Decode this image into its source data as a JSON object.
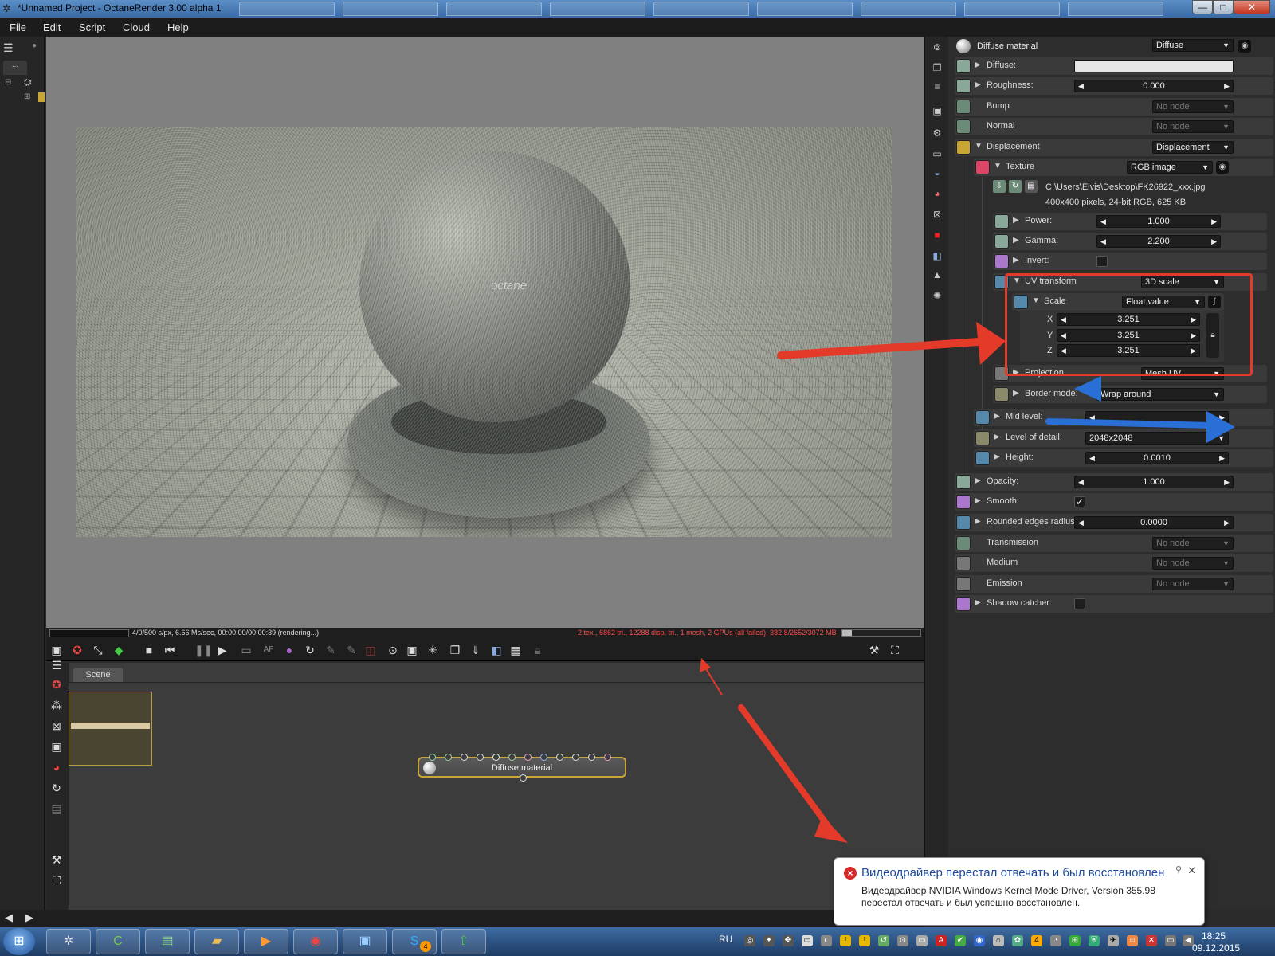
{
  "window": {
    "title": "*Unnamed Project - OctaneRender 3.00 alpha 1",
    "controls": [
      "—",
      "□",
      "✕"
    ]
  },
  "menu": [
    "File",
    "Edit",
    "Script",
    "Cloud",
    "Help"
  ],
  "left_panel": {
    "tab_label": "..."
  },
  "render_status": {
    "left": "4/0/500 s/px, 6.66 Ms/sec, 00:00:00/00:00:39 (rendering...)",
    "right": "2 tex., 6862 tri., 12288 disp. tri., 1 mesh, 2 GPUs (all failed), 382.8/2652/3072 MB"
  },
  "render_image": {
    "logo_text": "octane"
  },
  "graph": {
    "tab": "Scene",
    "node_label": "Diffuse material"
  },
  "inspector": {
    "header": {
      "title": "Diffuse material",
      "type": "Diffuse"
    },
    "diffuse": {
      "label": "Diffuse:"
    },
    "roughness": {
      "label": "Roughness:",
      "value": "0.000"
    },
    "bump": {
      "label": "Bump",
      "value": "No node"
    },
    "normal": {
      "label": "Normal",
      "value": "No node"
    },
    "displacement": {
      "label": "Displacement",
      "value": "Displacement"
    },
    "texture": {
      "label": "Texture",
      "value": "RGB image"
    },
    "file": {
      "path": "C:\\Users\\Elvis\\Desktop\\FK26922_xxx.jpg",
      "info": "400x400 pixels, 24-bit RGB, 625 KB"
    },
    "power": {
      "label": "Power:",
      "value": "1.000"
    },
    "gamma": {
      "label": "Gamma:",
      "value": "2.200"
    },
    "invert": {
      "label": "Invert:"
    },
    "uv_transform": {
      "label": "UV transform",
      "value": "3D scale"
    },
    "scale": {
      "label": "Scale",
      "value": "Float value",
      "x_label": "X",
      "y_label": "Y",
      "z_label": "Z",
      "x": "3.251",
      "y": "3.251",
      "z": "3.251"
    },
    "projection": {
      "label": "Projection",
      "value": "Mesh UV"
    },
    "border_mode": {
      "label": "Border mode:",
      "value": "Wrap around"
    },
    "mid_level": {
      "label": "Mid level:"
    },
    "level_of_detail": {
      "label": "Level of detail:",
      "value": "2048x2048"
    },
    "height": {
      "label": "Height:",
      "value": "0.0010"
    },
    "opacity": {
      "label": "Opacity:",
      "value": "1.000"
    },
    "smooth": {
      "label": "Smooth:",
      "checked": "✓"
    },
    "rounded": {
      "label": "Rounded edges radius:",
      "value": "0.0000"
    },
    "transmission": {
      "label": "Transmission",
      "value": "No node"
    },
    "medium": {
      "label": "Medium",
      "value": "No node"
    },
    "emission": {
      "label": "Emission",
      "value": "No node"
    },
    "shadow_catcher": {
      "label": "Shadow catcher:"
    }
  },
  "notification": {
    "title": "Видеодрайвер перестал отвечать и был восстановлен",
    "body": "Видеодрайвер NVIDIA Windows Kernel Mode Driver, Version 355.98  перестал отвечать и был успешно восстановлен."
  },
  "taskbar": {
    "language": "RU",
    "time": "18:25",
    "date": "09.12.2015",
    "skype_badge": "4"
  },
  "colors": {
    "annotation_red": "#e33a2a",
    "annotation_blue": "#2a6fd6",
    "status_red": "#ff4a4a"
  }
}
